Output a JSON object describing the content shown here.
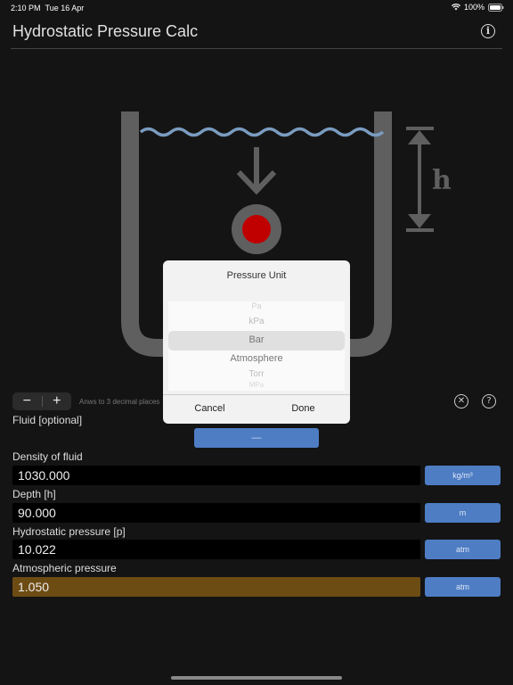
{
  "status": {
    "time": "2:10 PM",
    "date": "Tue 16 Apr",
    "battery": "100%"
  },
  "header": {
    "title": "Hydrostatic Pressure Calc",
    "info_icon": "info-icon"
  },
  "diagram": {
    "height_label": "h",
    "water_color": "#7a9cc0",
    "object_color": "#c00000"
  },
  "toolbar": {
    "minus": "−",
    "plus": "+",
    "precision_hint": "Anws to 3 decimal places",
    "clear_icon": "x-circle-icon",
    "help_icon": "question-icon",
    "clear_glyph": "✕",
    "help_glyph": "?"
  },
  "fluid": {
    "label": "Fluid [optional]",
    "button": "—"
  },
  "fields": [
    {
      "label": "Density of fluid",
      "value": "1030.000",
      "unit": "kg/m³"
    },
    {
      "label": "Depth [h]",
      "value": "90.000",
      "unit": "m"
    },
    {
      "label": "Hydrostatic pressure [p]",
      "value": "10.022",
      "unit": "atm"
    },
    {
      "label": "Atmospheric pressure",
      "value": "1.050",
      "unit": "atm"
    }
  ],
  "dialog": {
    "title": "Pressure Unit",
    "options": [
      "Pa",
      "kPa",
      "Bar",
      "Atmosphere",
      "Torr",
      "MPa"
    ],
    "selected": "Bar",
    "cancel": "Cancel",
    "done": "Done"
  },
  "colors": {
    "accent": "#4e7dc4",
    "highlight_field": "#6d4c14",
    "background": "#141414"
  }
}
